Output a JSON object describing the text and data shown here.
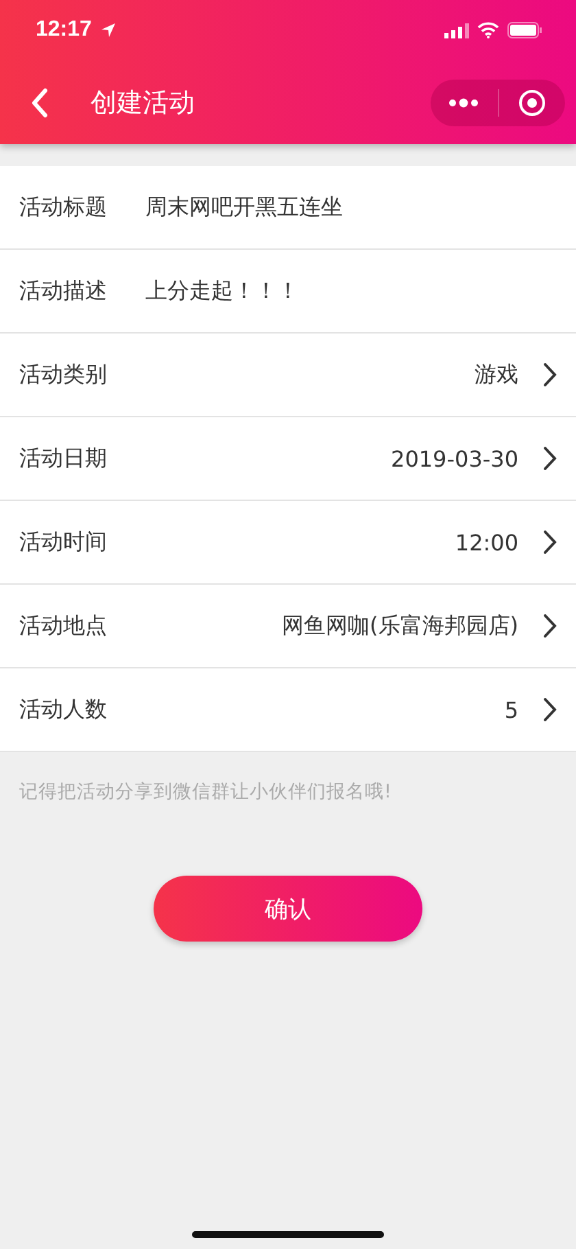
{
  "status_bar": {
    "time": "12:17"
  },
  "nav": {
    "title": "创建活动"
  },
  "fields": [
    {
      "kind": "text",
      "label": "活动标题",
      "value": "周末网吧开黑五连坐"
    },
    {
      "kind": "text",
      "label": "活动描述",
      "value": "上分走起！！！"
    },
    {
      "kind": "select",
      "label": "活动类别",
      "value": "游戏"
    },
    {
      "kind": "select",
      "label": "活动日期",
      "value": "2019-03-30"
    },
    {
      "kind": "select",
      "label": "活动时间",
      "value": "12:00"
    },
    {
      "kind": "select",
      "label": "活动地点",
      "value": "网鱼网咖(乐富海邦园店)"
    },
    {
      "kind": "select",
      "label": "活动人数",
      "value": "5"
    }
  ],
  "hint": "记得把活动分享到微信群让小伙伴们报名哦!",
  "confirm_button": "确认"
}
